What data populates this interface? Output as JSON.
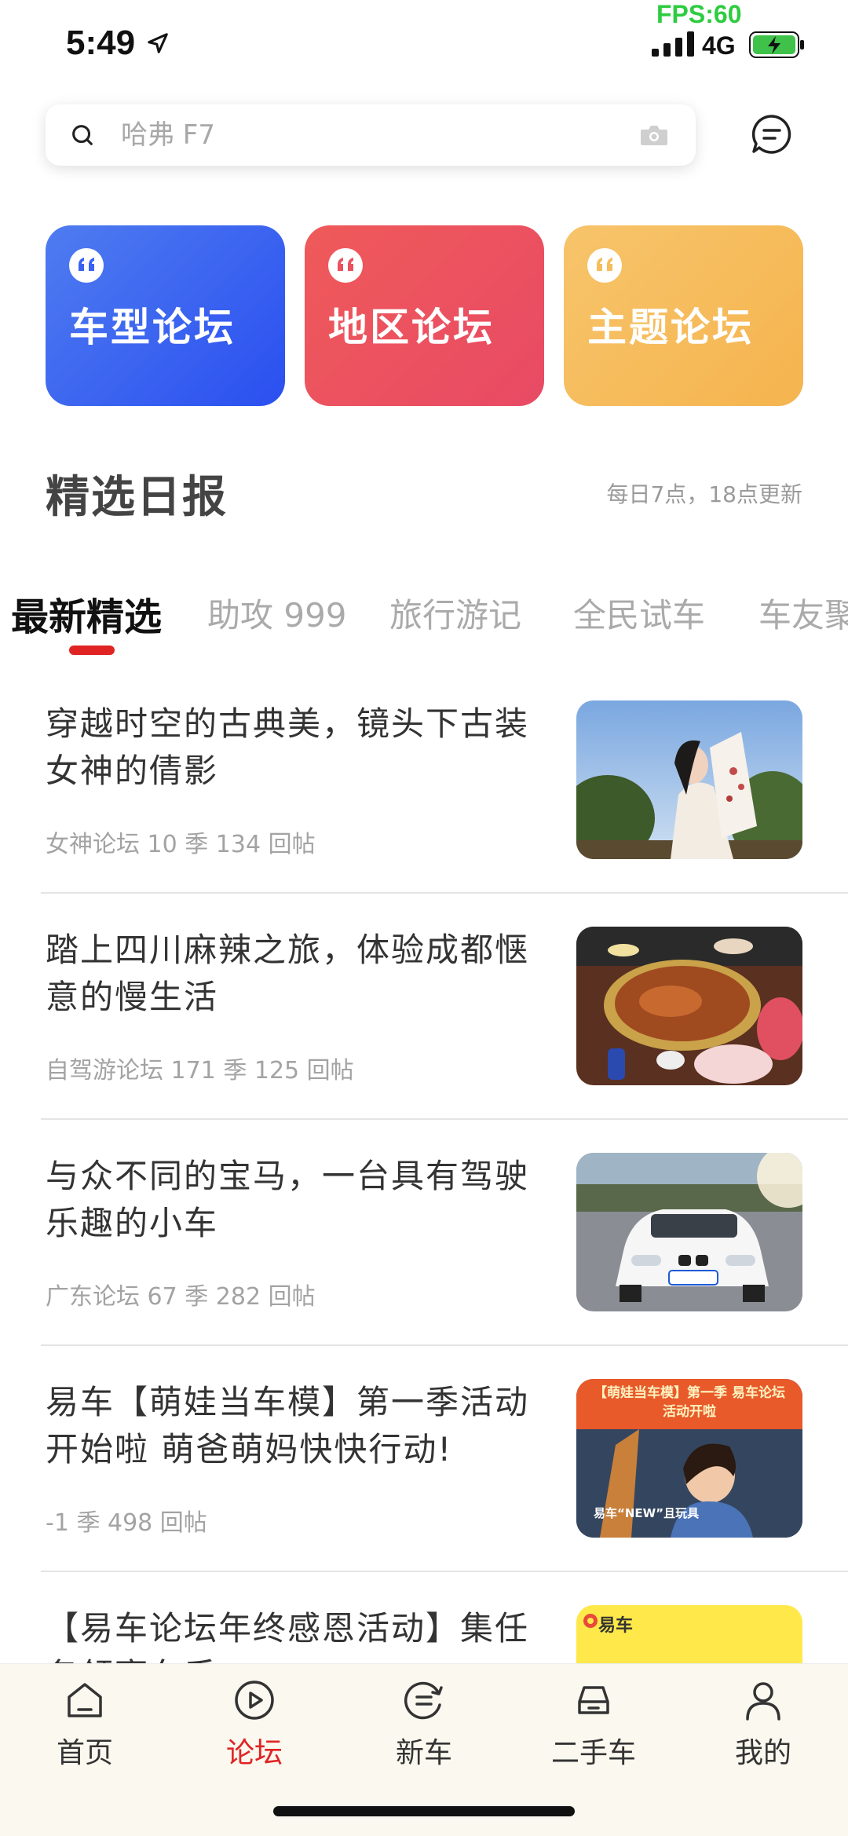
{
  "status_bar": {
    "time": "5:49",
    "fps": "FPS:60",
    "network": "4G"
  },
  "search": {
    "placeholder": "哈弗 F7"
  },
  "forum_cards": [
    {
      "label": "车型论坛",
      "color": "#3a62f2"
    },
    {
      "label": "地区论坛",
      "color": "#ea5260"
    },
    {
      "label": "主题论坛",
      "color": "#f6bd5d"
    }
  ],
  "section": {
    "title": "精选日报",
    "subtitle": "每日7点，18点更新"
  },
  "tabs": [
    "最新精选",
    "助攻 999",
    "旅行游记",
    "全民试车",
    "车友聚"
  ],
  "articles": [
    {
      "title": "穿越时空的古典美，镜头下古装女神的倩影",
      "meta": "女神论坛 10 季  134 回帖"
    },
    {
      "title": "踏上四川麻辣之旅，体验成都惬意的慢生活",
      "meta": "自驾游论坛 171 季  125 回帖"
    },
    {
      "title": "与众不同的宝马，一台具有驾驶乐趣的小车",
      "meta": "广东论坛 67 季  282 回帖"
    },
    {
      "title": "易车【萌娃当车模】第一季活动开始啦 萌爸萌妈快快行动!",
      "meta": "-1 季  498 回帖",
      "thumb_banner": "【萌娃当车模】第一季 易车论坛活动开啦",
      "thumb_caption": "易车“NEW”且玩具"
    },
    {
      "title": "【易车论坛年终感恩活动】集任务领豪车手",
      "meta": "",
      "thumb_logo": "易车"
    }
  ],
  "tabbar": [
    {
      "label": "首页",
      "icon": "home-icon"
    },
    {
      "label": "论坛",
      "icon": "play-circle-icon",
      "active": true
    },
    {
      "label": "新车",
      "icon": "new-car-icon"
    },
    {
      "label": "二手车",
      "icon": "used-car-icon"
    },
    {
      "label": "我的",
      "icon": "profile-icon"
    }
  ],
  "colors": {
    "accent": "#e02424",
    "fps_green": "#2ecc40"
  }
}
